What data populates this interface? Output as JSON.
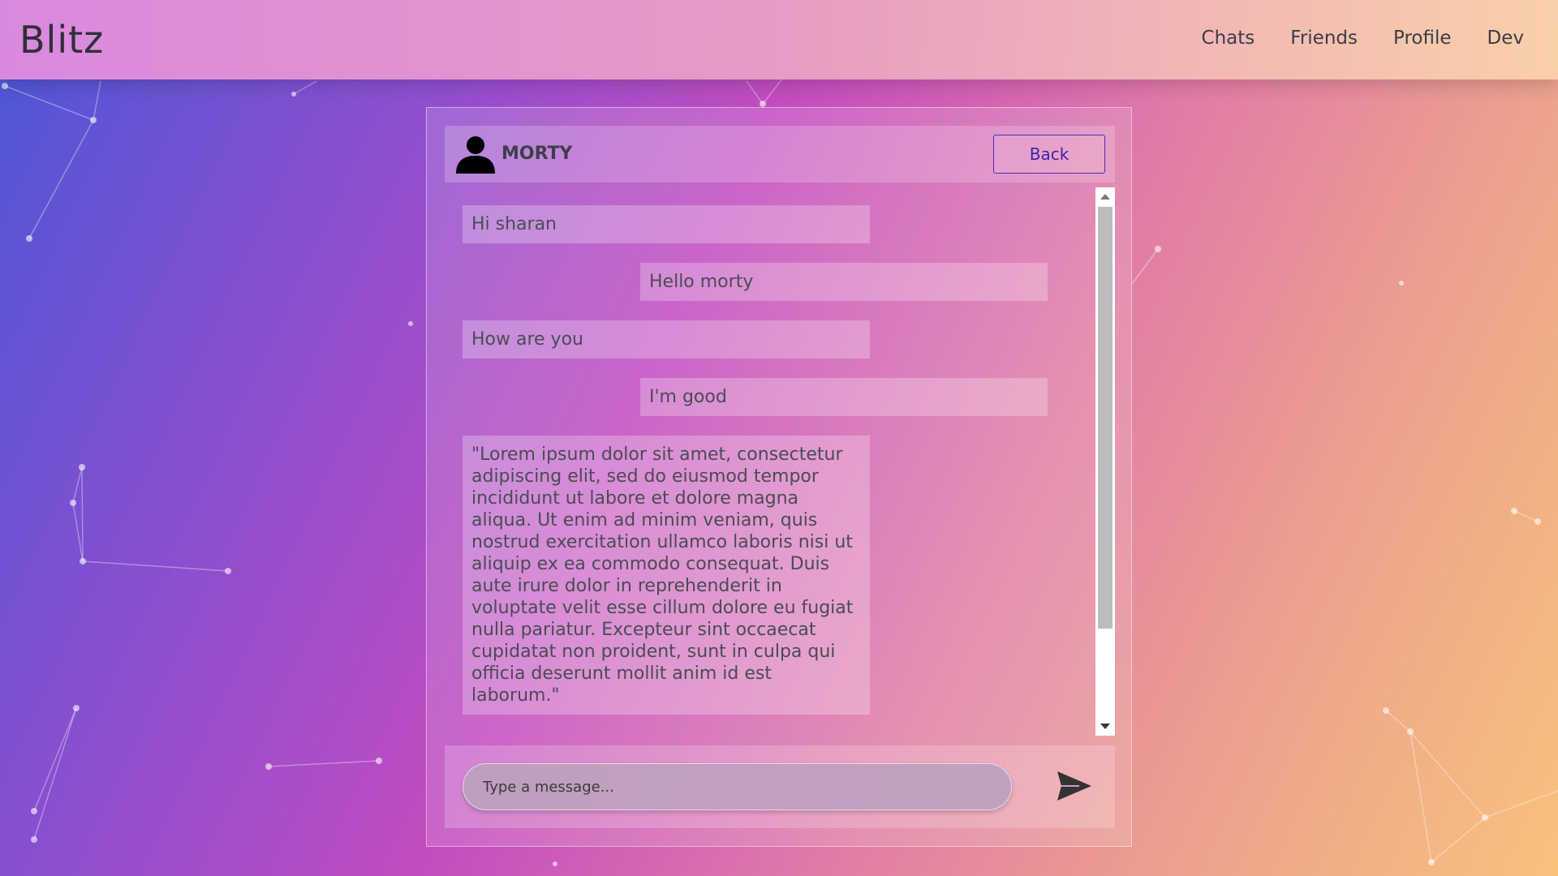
{
  "app": {
    "logo": "Blitz",
    "nav": [
      "Chats",
      "Friends",
      "Profile",
      "Dev"
    ]
  },
  "chat": {
    "contact_name": "MORTY",
    "back_label": "Back",
    "messages": [
      {
        "side": "left",
        "text": "Hi sharan"
      },
      {
        "side": "right",
        "text": "Hello morty"
      },
      {
        "side": "left",
        "text": "How are you"
      },
      {
        "side": "right",
        "text": "I'm good"
      },
      {
        "side": "left",
        "text": "\"Lorem ipsum dolor sit amet, consectetur adipiscing elit, sed do eiusmod tempor incididunt ut labore et dolore magna aliqua. Ut enim ad minim veniam, quis nostrud exercitation ullamco laboris nisi ut aliquip ex ea commodo consequat. Duis aute irure dolor in reprehenderit in voluptate velit esse cillum dolore eu fugiat nulla pariatur. Excepteur sint occaecat cupidatat non proident, sunt in culpa qui officia deserunt mollit anim id est laborum.\""
      }
    ],
    "input_placeholder": "Type a message...",
    "input_value": ""
  },
  "icons": {
    "avatar": "user-icon",
    "send": "send-icon",
    "scroll_up": "scroll-up-arrow-icon",
    "scroll_down": "scroll-down-arrow-icon"
  }
}
